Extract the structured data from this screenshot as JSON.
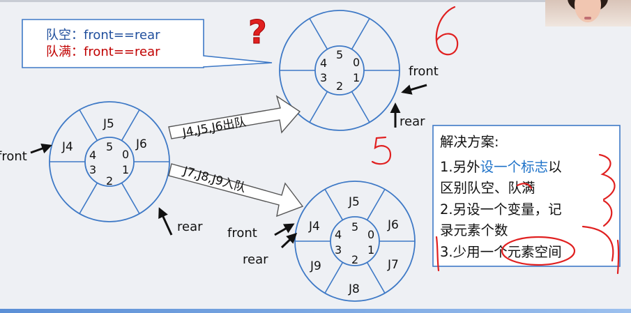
{
  "callout": {
    "empty_label": "队空：front==rear",
    "full_label": "队满：front==rear"
  },
  "circle_top": {
    "indices": [
      "0",
      "1",
      "2",
      "3",
      "4",
      "5"
    ],
    "front_label": "front",
    "rear_label": "rear"
  },
  "circle_left": {
    "cells": [
      "J5",
      "J6",
      "J4"
    ],
    "indices": [
      "0",
      "1",
      "2",
      "3",
      "4",
      "5"
    ],
    "front_label": "front",
    "rear_label": "rear"
  },
  "circle_bottom": {
    "cells": [
      "J5",
      "J6",
      "J7",
      "J8",
      "J9",
      "J4"
    ],
    "indices": [
      "0",
      "1",
      "2",
      "3",
      "4",
      "5"
    ],
    "front_label": "front",
    "rear_label": "rear"
  },
  "arrows": {
    "dequeue_label": "J4,J5,J6出队",
    "enqueue_label": "J7,J8,J9入队"
  },
  "solution": {
    "title": "解决方案:",
    "line1_a": "1.另外",
    "line1_b": "设一个标志",
    "line1_c": "以",
    "line2": "区别队空、队满",
    "line3": "2.另设一个变量，记",
    "line4": "录元素个数",
    "line5": "3.少用一个元素空间"
  },
  "question_mark": "?",
  "annotations": {
    "six": "6",
    "five": "5"
  },
  "colors": {
    "ring_blue": "#3e79c6",
    "full_red": "#c00000",
    "highlight_blue": "#1f73c9",
    "pen_red": "#e02020"
  }
}
